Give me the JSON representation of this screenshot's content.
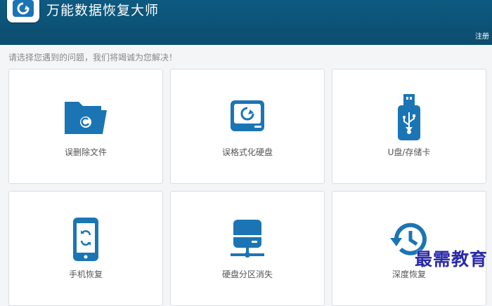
{
  "app": {
    "title": "万能数据恢复大师",
    "register_label": "注册",
    "logo_icon": "refresh-drive-icon"
  },
  "main": {
    "prompt": "请选择您遇到的问题，我们将竭诚为您解决！",
    "options": [
      {
        "label": "误删除文件",
        "icon": "folder-recover-icon"
      },
      {
        "label": "误格式化硬盘",
        "icon": "hard-drive-recover-icon"
      },
      {
        "label": "U盘/存储卡",
        "icon": "usb-drive-icon"
      },
      {
        "label": "手机恢复",
        "icon": "phone-recover-icon"
      },
      {
        "label": "硬盘分区消失",
        "icon": "drive-partition-icon"
      },
      {
        "label": "深度恢复",
        "icon": "history-icon"
      }
    ]
  },
  "watermark": {
    "text": "最需教育"
  },
  "colors": {
    "titlebar": "#0b4d6f",
    "accent": "#1b75b5",
    "background": "#f4f5f7",
    "card": "#ffffff"
  }
}
